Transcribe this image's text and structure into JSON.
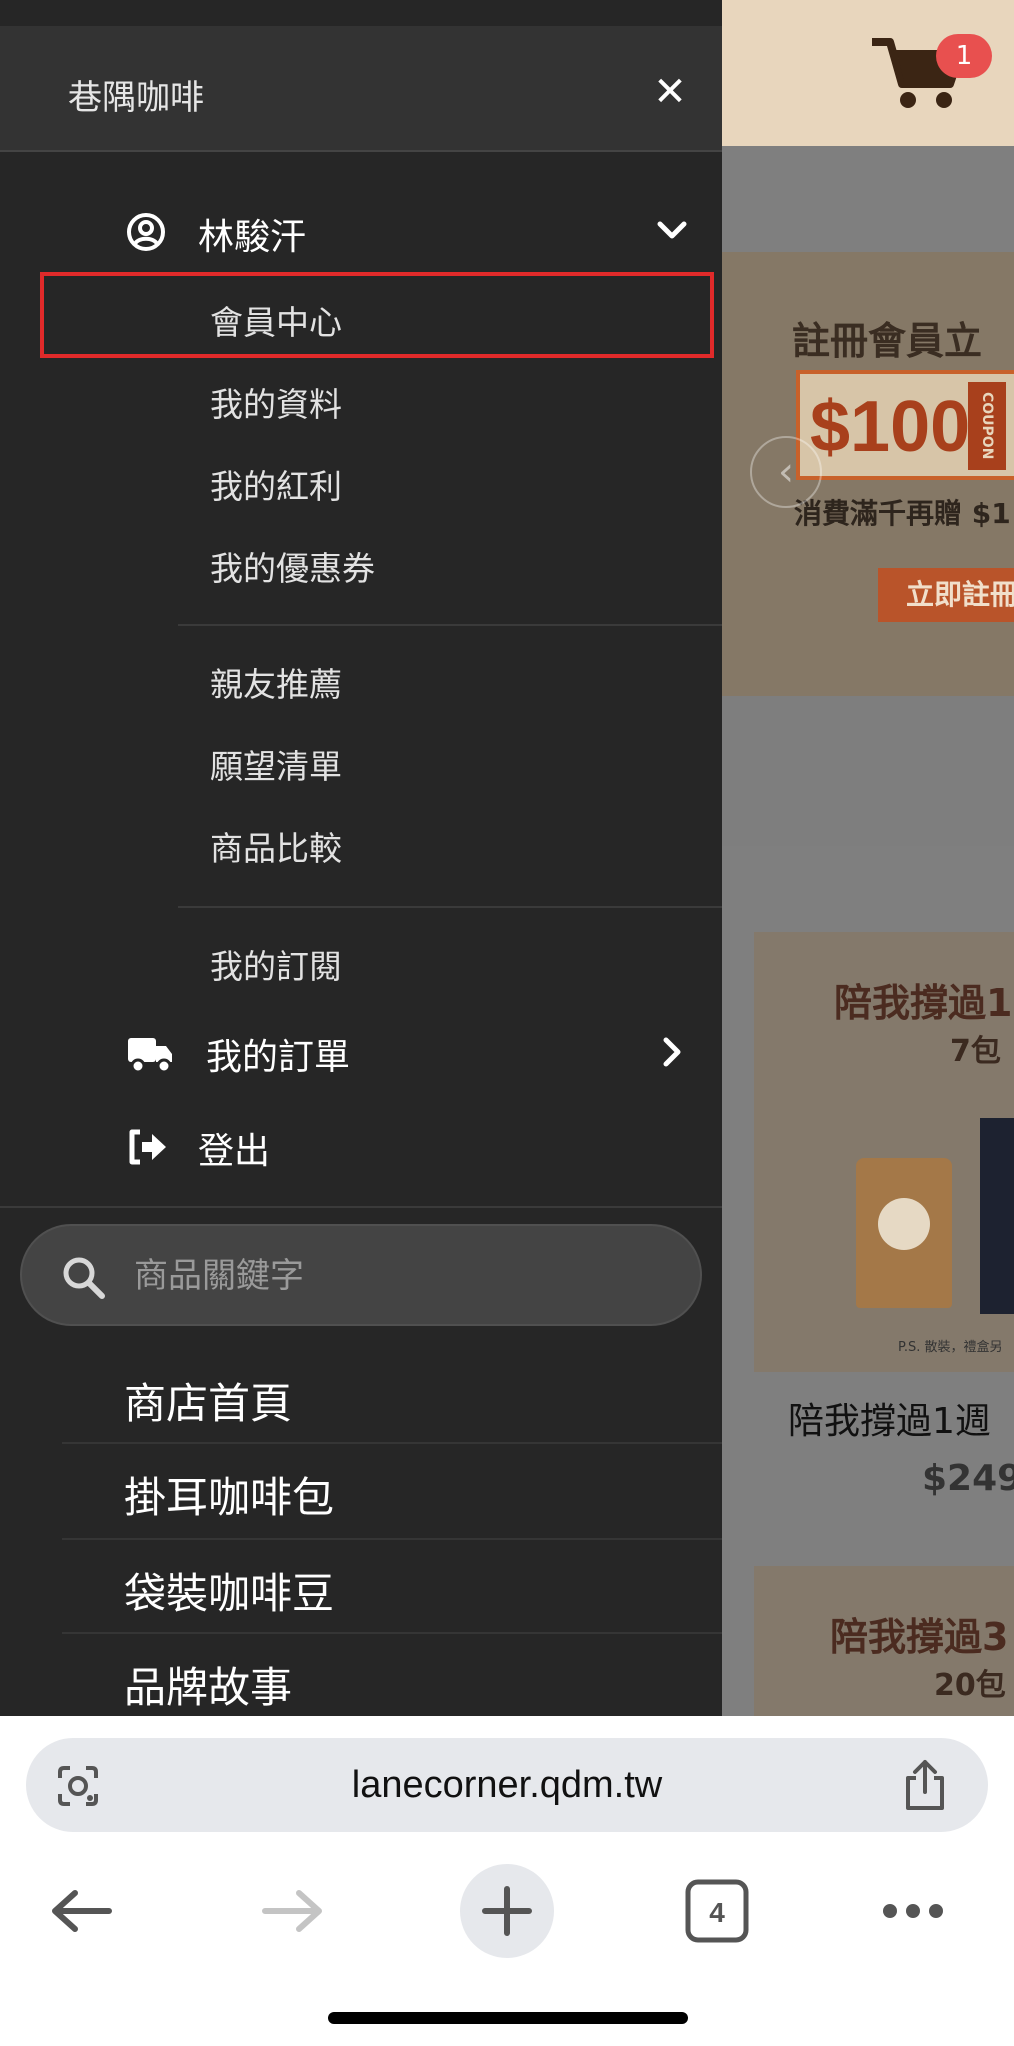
{
  "background_page": {
    "cart_count": "1",
    "banner": {
      "headline": "註冊會員立",
      "coupon_amount": "$100",
      "coupon_word": "COUPON",
      "subline": "消費滿千再贈 $1",
      "button": "立即註冊"
    },
    "products": [
      {
        "title": "陪我撐過1",
        "subtitle": "7包",
        "note": "P.S. 散裝，禮盒另",
        "name": "陪我撐過1週",
        "price": "$249"
      },
      {
        "title": "陪我撐過3",
        "subtitle": "20包"
      }
    ]
  },
  "drawer": {
    "title": "巷隅咖啡",
    "user": {
      "name": "林駿汗"
    },
    "member_items": [
      "會員中心",
      "我的資料",
      "我的紅利",
      "我的優惠券"
    ],
    "extra_items": [
      "親友推薦",
      "願望清單",
      "商品比較"
    ],
    "subscription_item": "我的訂閱",
    "orders_label": "我的訂單",
    "logout_label": "登出",
    "search_placeholder": "商品關鍵字",
    "nav_links": [
      "商店首頁",
      "掛耳咖啡包",
      "袋裝咖啡豆",
      "品牌故事"
    ]
  },
  "browser": {
    "url": "lanecorner.qdm.tw",
    "tab_count": "4"
  },
  "colors": {
    "highlight": "#e02a2a",
    "drawer_bg": "#262626",
    "header_bg": "#e8d6bd"
  },
  "icons": [
    "close-icon",
    "user-circle-icon",
    "chevron-down-icon",
    "truck-icon",
    "chevron-right-icon",
    "logout-icon",
    "search-icon",
    "cart-icon",
    "lens-icon",
    "share-icon",
    "back-arrow-icon",
    "forward-arrow-icon",
    "plus-icon",
    "tabs-icon",
    "more-icon"
  ]
}
